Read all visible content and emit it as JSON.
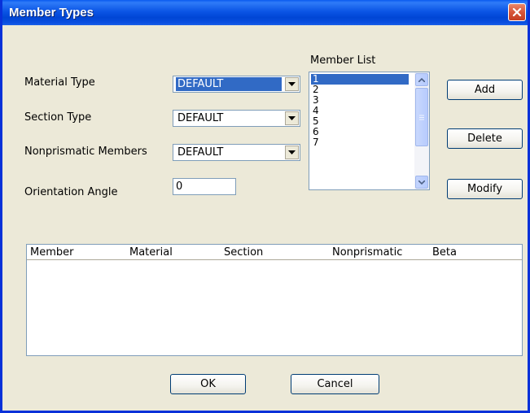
{
  "window": {
    "title": "Member Types"
  },
  "labels": {
    "material_type": "Material Type",
    "section_type": "Section Type",
    "nonprismatic_members": "Nonprismatic Members",
    "orientation_angle": "Orientation Angle",
    "member_list": "Member List"
  },
  "fields": {
    "material_type": "DEFAULT",
    "section_type": "DEFAULT",
    "nonprismatic_members": "DEFAULT",
    "orientation_angle": "0"
  },
  "member_list": {
    "items": [
      "1",
      "2",
      "3",
      "4",
      "5",
      "6",
      "7"
    ],
    "selected": "1"
  },
  "buttons": {
    "add": "Add",
    "delete": "Delete",
    "modify": "Modify",
    "ok": "OK",
    "cancel": "Cancel"
  },
  "table": {
    "columns": [
      "Member",
      "Material",
      "Section",
      "Nonprismatic",
      "Beta"
    ],
    "rows": []
  },
  "colors": {
    "titlebar": "#0054e3",
    "selection": "#316ac5",
    "dialog_bg": "#ece9d8",
    "close": "#d7563a"
  }
}
